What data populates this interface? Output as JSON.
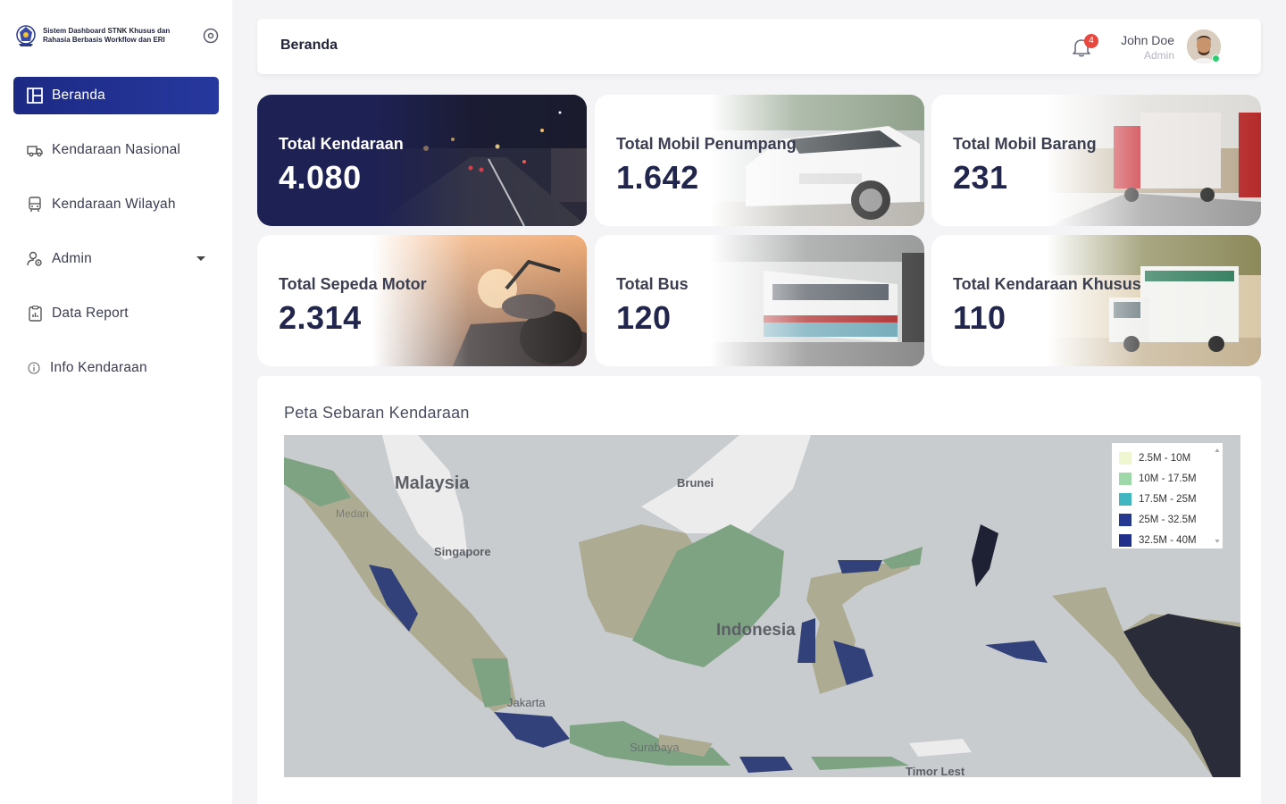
{
  "brand": {
    "title": "Sistem Dashboard STNK Khusus dan Rahasia Berbasis Workflow dan ERI"
  },
  "sidebar": {
    "items": [
      {
        "label": "Beranda",
        "icon": "layout-icon",
        "active": true
      },
      {
        "label": "Kendaraan Nasional",
        "icon": "truck-icon"
      },
      {
        "label": "Kendaraan Wilayah",
        "icon": "bus-icon"
      },
      {
        "label": "Admin",
        "icon": "user-gear-icon",
        "has_dropdown": true
      },
      {
        "label": "Data Report",
        "icon": "clipboard-icon"
      },
      {
        "label": "Info Kendaraan",
        "icon": "info-icon"
      }
    ]
  },
  "header": {
    "title": "Beranda",
    "notification_count": "4",
    "user_name": "John Doe",
    "user_role": "Admin"
  },
  "cards": [
    {
      "label": "Total Kendaraan",
      "value": "4.080"
    },
    {
      "label": "Total Mobil Penumpang",
      "value": "1.642"
    },
    {
      "label": "Total Mobil Barang",
      "value": "231"
    },
    {
      "label": "Total Sepeda Motor",
      "value": "2.314"
    },
    {
      "label": "Total Bus",
      "value": "120"
    },
    {
      "label": "Total Kendaraan Khusus",
      "value": "110"
    }
  ],
  "map": {
    "title": "Peta Sebaran Kendaraan",
    "legend": [
      {
        "label": "2.5M - 10M",
        "color": "#eef6d2"
      },
      {
        "label": "10M - 17.5M",
        "color": "#9ed8a8"
      },
      {
        "label": "17.5M - 25M",
        "color": "#3fb6c0"
      },
      {
        "label": "25M - 32.5M",
        "color": "#24398f"
      },
      {
        "label": "32.5M - 40M",
        "color": "#1f2f8a"
      }
    ],
    "place_labels": {
      "malaysia": "Malaysia",
      "brunei": "Brunei",
      "medan": "Medan",
      "singapore": "Singapore",
      "indonesia": "Indonesia",
      "jakarta": "Jakarta",
      "surabaya": "Surabaya",
      "timor": "Timor Lest"
    }
  },
  "colors": {
    "accent": "#1c2a84",
    "dark_card": "#1e2154",
    "badge": "#e8483f",
    "online": "#2ecc71"
  }
}
